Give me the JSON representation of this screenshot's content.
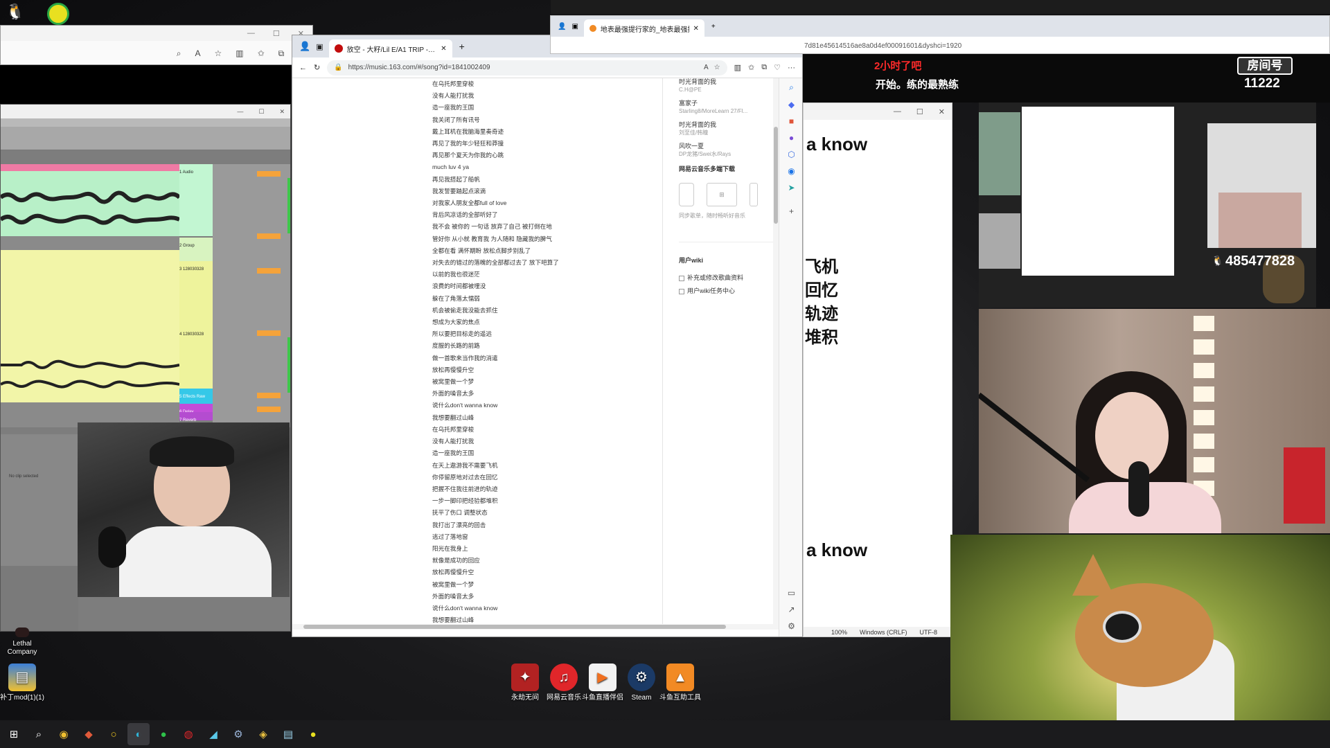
{
  "stream_overlay": {
    "timer_text": "2小时了吧",
    "practice_text": "开始。练的最熟练",
    "room_label": "房间号",
    "room_number": "11222",
    "qq_number": "485477828",
    "bg_lyrics": [
      "a know",
      "飞机",
      "回忆",
      "轨迹",
      "堆积",
      "a know"
    ]
  },
  "browser_main": {
    "tab_title": "放空 - 大籽/Lil E/A1 TRIP - 单曲",
    "url": "https://music.163.com/#/song?id=1841002409",
    "lyrics": [
      "在乌托邦里穿梭",
      "没有人能打扰我",
      "造一座我的王国",
      "我关闭了所有讯号",
      "戴上耳机在我脑海里奏奇迹",
      "再见了我的年少轻狂和莽撞",
      "再见那个夏天为你我的心跳",
      "much luv 4 ya",
      "再见我搭起了船帆",
      "我发誓要踏起点滚滴",
      "对我家人朋友全都full of love",
      "背后风凉话的全部听好了",
      "我不会 被你的 一句话 放弃了自己 被打倒在地",
      "管好你 从小就 教育我 为人随和 隐藏我的脾气",
      "全都在看 满怀期盼 放松点脚步别乱了",
      "对失去的错过的落魄的全部都过去了 放下吧算了",
      "以前的我也很迷茫",
      "浪费的时间都被埋没",
      "躲在了角落太懦弱",
      "机会被偷走我没能去抓住",
      "想成为大家的焦点",
      "所以要把目标走的遥远",
      "度服的长路的前路",
      "做一首歌来当作我的消遣",
      "放松再慢慢升空",
      "被窝里做一个梦",
      "外面的噪音太多",
      "说什么don't wanna know",
      "我想要翻过山峰",
      "在乌托邦里穿梭",
      "没有人能打扰我",
      "造一座我的王国",
      "在天上遨游我不需要飞机",
      "你停留原地对过去在回忆",
      "把握不住我往前进的轨迹",
      "一步一脚印把经验都堆积",
      "抚平了伤口 调整状态",
      "我打出了漂亮的回击",
      "逃过了落地窗",
      "阳光在我身上",
      "就像是成功的回应",
      "放松再慢慢升空",
      "被窝里做一个梦",
      "外面的噪音太多",
      "说什么don't wanna know",
      "我想要翻过山峰"
    ],
    "side_list": [
      {
        "title": "时光背面的我",
        "sub": "C.H@PE"
      },
      {
        "title": "富家子",
        "sub": "Starling8/MoreLearn 27/Fl..."
      },
      {
        "title": "时光背面的我",
        "sub": "刘至佳/韩瞳"
      },
      {
        "title": "风吹一夏",
        "sub": "DP龙猪/Swei水/Rays"
      }
    ],
    "download_heading": "网易云音乐多端下载",
    "download_sub": "同步歌单，随时畅听好音乐",
    "wiki_heading": "用户wiki",
    "wiki_items": [
      "补充或修改歌曲资料",
      "用户wiki任务中心"
    ]
  },
  "browser_back": {
    "tab_title": "地表最强提行家的_地表最强提行",
    "url_fragment": "7d81e45614516ae8a0d4ef00091601&dyshci=1920"
  },
  "notepad_status": {
    "zoom": "100%",
    "eol": "Windows (CRLF)",
    "encoding": "UTF-8"
  },
  "daw": {
    "tracks": [
      "1 Audio",
      "2 Group",
      "3 128030328",
      "4 128030328",
      "5 Effects Raw",
      "6 Delay",
      "7 Reverb"
    ],
    "empty_text": "No clip selected"
  },
  "desktop_icons": [
    {
      "label": "Lethal Company"
    },
    {
      "label": "补丁mod(1)(1)"
    },
    {
      "label": "永劫无间"
    },
    {
      "label": "网易云音乐"
    },
    {
      "label": "斗鱼直播伴侣"
    },
    {
      "label": "Steam"
    },
    {
      "label": "斗鱼互助工具"
    }
  ],
  "taskbar": {
    "items": [
      "windows-icon",
      "search-icon",
      "chrome-icon",
      "app-icon",
      "ring-icon",
      "edge-icon",
      "wechat-icon",
      "netease-icon",
      "stream-icon",
      "steam-icon",
      "game-icon",
      "notepad-icon",
      "browser-icon"
    ]
  },
  "colors": {
    "accent_red": "#c20c0c",
    "overlay_red": "#ff2a2a",
    "daw_green": "#b8f0c8",
    "daw_yellow": "#f2f5a8"
  }
}
